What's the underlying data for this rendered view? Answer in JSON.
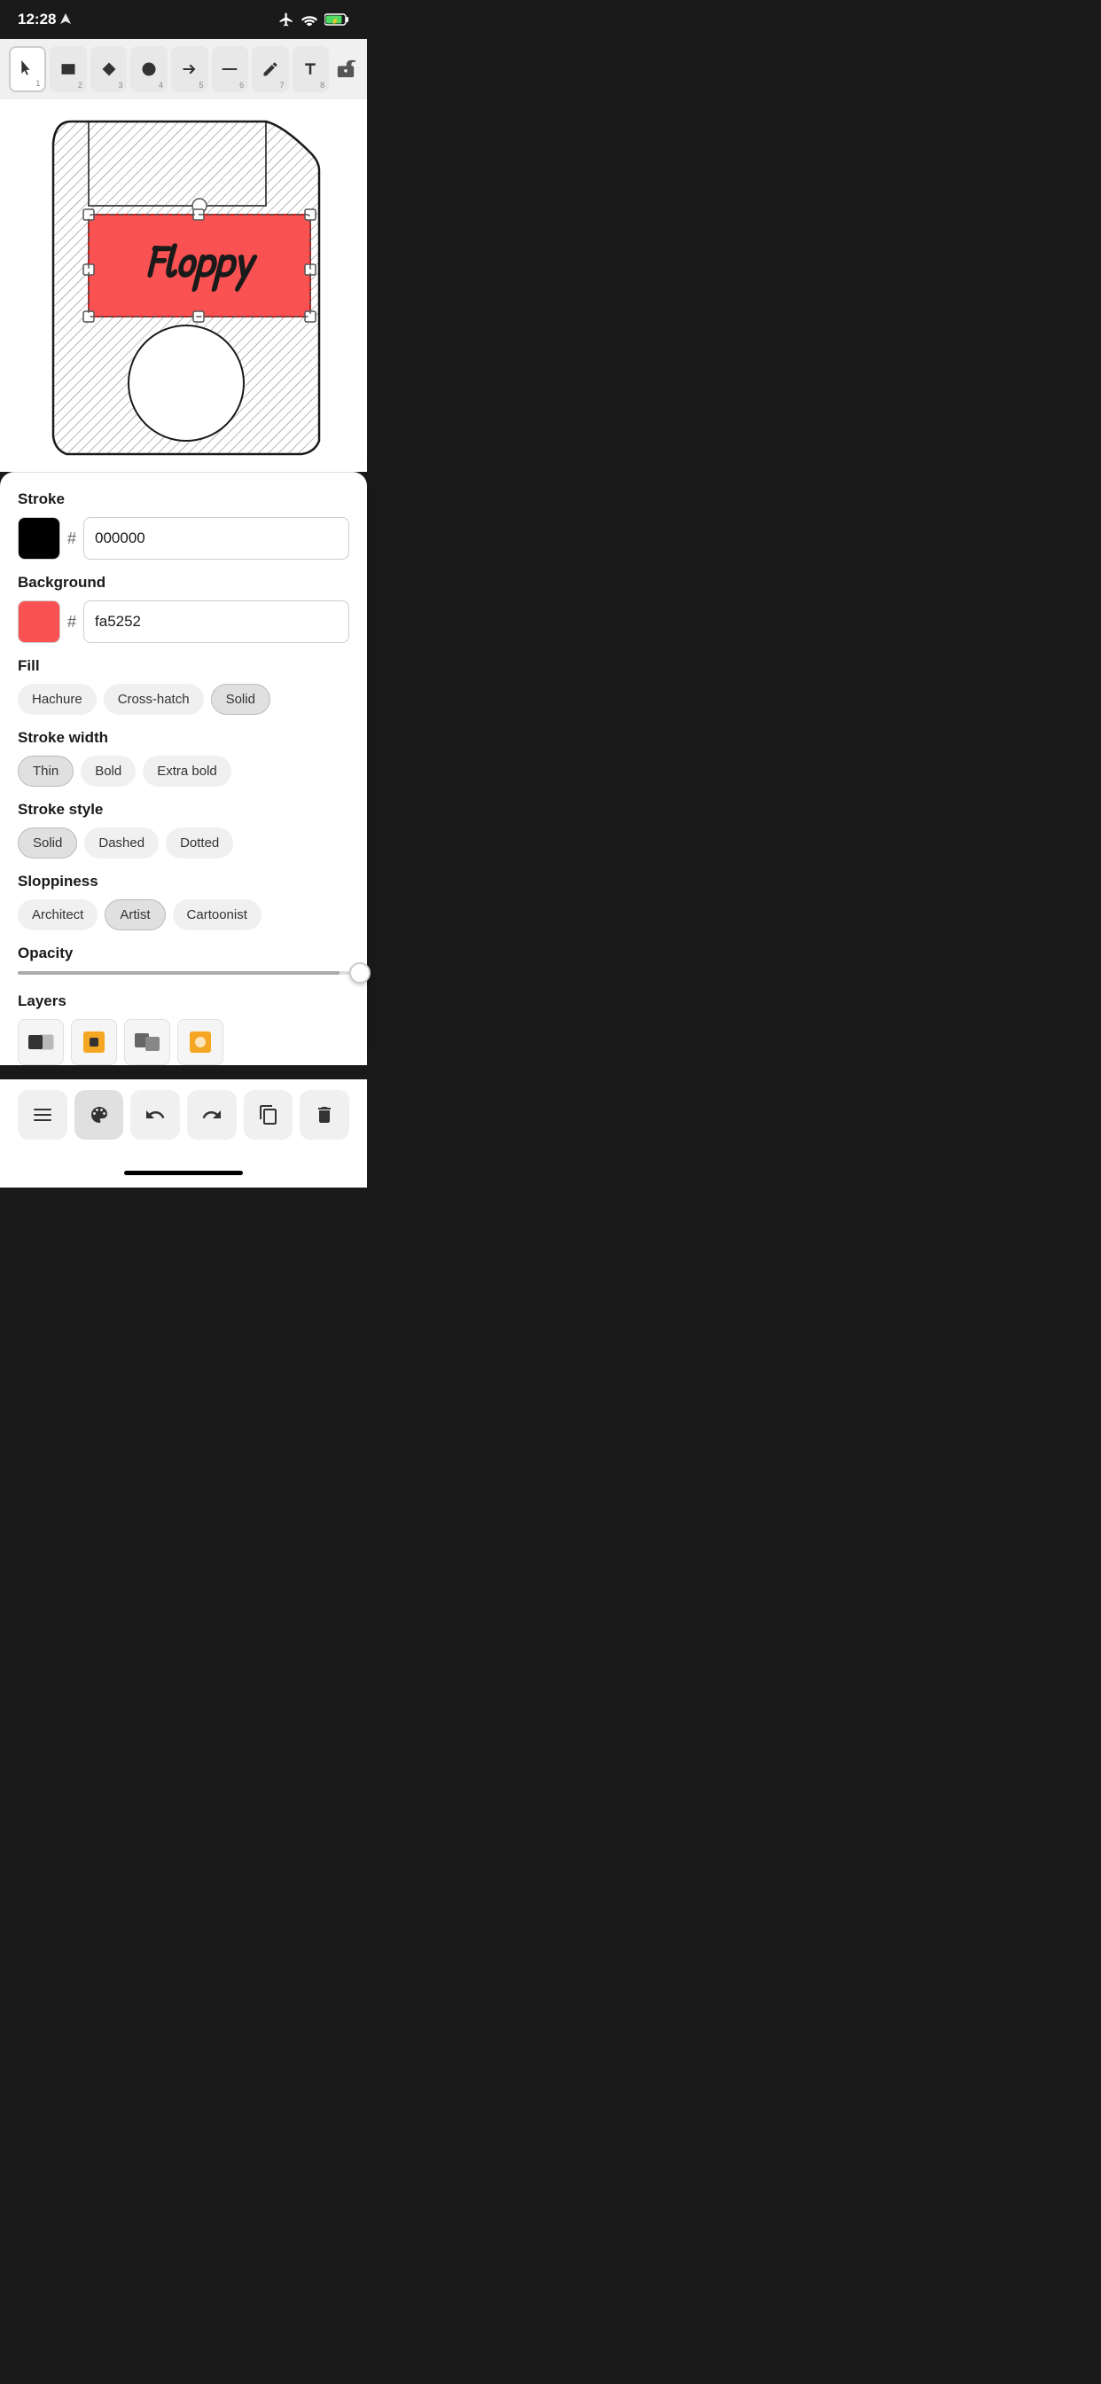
{
  "statusBar": {
    "time": "12:28",
    "locationIcon": "location-arrow-icon"
  },
  "toolbar": {
    "tools": [
      {
        "id": "select",
        "label": "▲",
        "num": "1",
        "active": true
      },
      {
        "id": "rect",
        "label": "■",
        "num": "2",
        "active": false
      },
      {
        "id": "diamond",
        "label": "◆",
        "num": "3",
        "active": false
      },
      {
        "id": "ellipse",
        "label": "●",
        "num": "4",
        "active": false
      },
      {
        "id": "arrow",
        "label": "→",
        "num": "5",
        "active": false
      },
      {
        "id": "line",
        "label": "—",
        "num": "6",
        "active": false
      },
      {
        "id": "pencil",
        "label": "✏",
        "num": "7",
        "active": false
      },
      {
        "id": "text",
        "label": "A",
        "num": "8",
        "active": false
      }
    ],
    "lockLabel": "🔓"
  },
  "properties": {
    "strokeLabel": "Stroke",
    "strokeColor": "#000000",
    "strokeHex": "000000",
    "backgroundLabel": "Background",
    "bgColor": "#fa5252",
    "bgHex": "fa5252",
    "fillLabel": "Fill",
    "fillOptions": [
      {
        "label": "Hachure",
        "selected": false
      },
      {
        "label": "Cross-hatch",
        "selected": false
      },
      {
        "label": "Solid",
        "selected": true
      }
    ],
    "strokeWidthLabel": "Stroke width",
    "strokeWidthOptions": [
      {
        "label": "Thin",
        "selected": true
      },
      {
        "label": "Bold",
        "selected": false
      },
      {
        "label": "Extra bold",
        "selected": false
      }
    ],
    "strokeStyleLabel": "Stroke style",
    "strokeStyleOptions": [
      {
        "label": "Solid",
        "selected": true
      },
      {
        "label": "Dashed",
        "selected": false
      },
      {
        "label": "Dotted",
        "selected": false
      }
    ],
    "sloppinessLabel": "Sloppiness",
    "sloppinessOptions": [
      {
        "label": "Architect",
        "selected": false
      },
      {
        "label": "Artist",
        "selected": true
      },
      {
        "label": "Cartoonist",
        "selected": false
      }
    ],
    "opacityLabel": "Opacity",
    "opacityValue": 100,
    "layersLabel": "Layers"
  },
  "layers": [
    {
      "id": "layer-1",
      "icon": "◧◨"
    },
    {
      "id": "layer-2",
      "icon": "🟧"
    },
    {
      "id": "layer-3",
      "icon": "⧉"
    },
    {
      "id": "layer-4",
      "icon": "🟧"
    }
  ],
  "actionBar": {
    "menuIcon": "≡",
    "paletteIcon": "🎨",
    "undoIcon": "↺",
    "redoIcon": "↻",
    "copyIcon": "⧉",
    "deleteIcon": "🗑"
  },
  "canvas": {
    "floppyText": "Floppy"
  }
}
